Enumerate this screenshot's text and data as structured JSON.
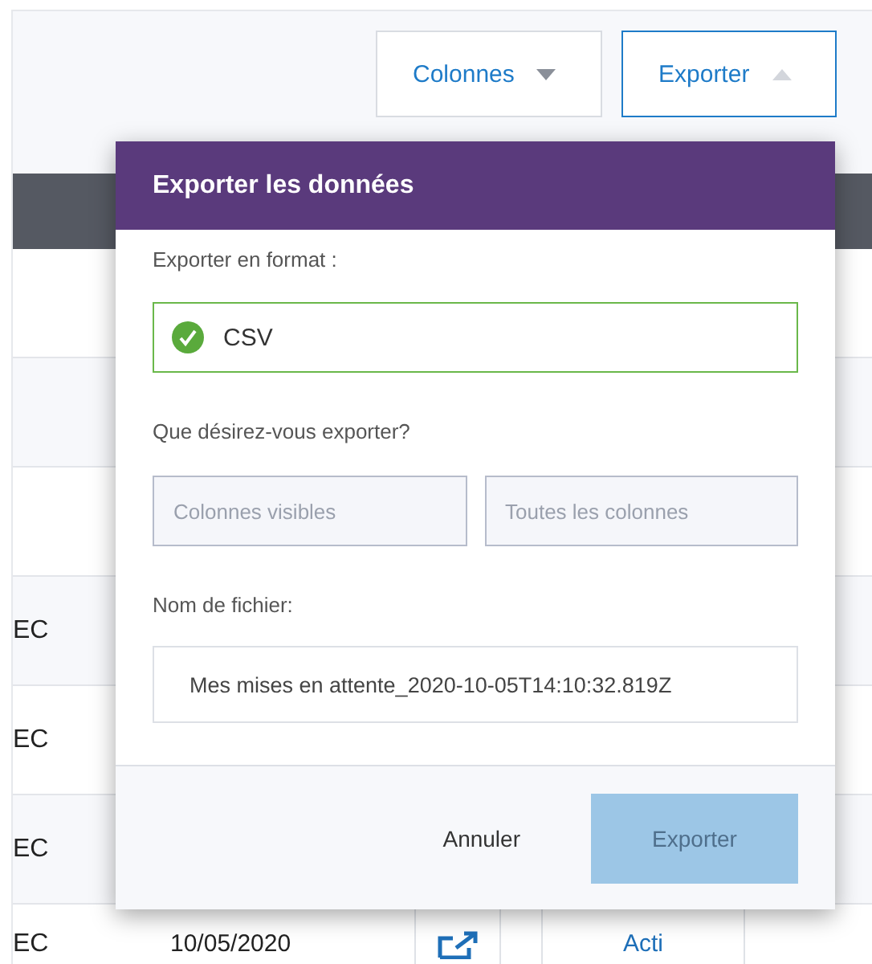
{
  "toolbar": {
    "buttons": [
      {
        "label": "Colonnes",
        "expanded": false
      },
      {
        "label": "Exporter",
        "expanded": true
      }
    ]
  },
  "table": {
    "rows": [
      {},
      {},
      {},
      {
        "column_1": "EC"
      },
      {
        "column_1": "EC"
      },
      {
        "column_1": "EC"
      },
      {
        "column_1": "EC",
        "column_2": "10/05/2020",
        "column_4": "Acti"
      }
    ]
  },
  "export_dialog": {
    "title": "Exporter les données",
    "format_label": "Exporter en format :",
    "format_option": {
      "label": "CSV",
      "selected": true
    },
    "scope_label": "Que désirez-vous exporter?",
    "scope_options": [
      {
        "label": "Colonnes visibles",
        "selected": false
      },
      {
        "label": "Toutes les colonnes",
        "selected": false
      }
    ],
    "filename_label": "Nom de fichier:",
    "filename_value": "Mes mises en attente_2020-10-05T14:10:32.819Z",
    "cancel_button": "Annuler",
    "submit_button": {
      "label": "Exporter",
      "disabled": true
    }
  }
}
